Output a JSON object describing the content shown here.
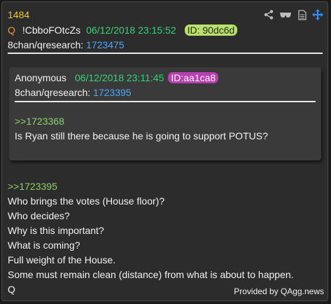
{
  "post": {
    "number": "1484",
    "q_mark": "Q",
    "tripcode": "!CbboFOtcZs",
    "date": "06/12/2018 23:15:52",
    "id": "ID: 90dc6d",
    "board": "8chan/qresearch:",
    "post_link": "1723475"
  },
  "toolbar": {
    "icons": [
      "share-icon",
      "glasses-icon",
      "document-icon",
      "move-icon"
    ],
    "accent": "#2f8fff"
  },
  "quoted": {
    "author": "Anonymous",
    "date": "06/12/2018 23:11:45",
    "id": "ID:aa1ca8",
    "board": "8chan/qresearch:",
    "post_link": "1723395",
    "reply_ref": ">>1723368",
    "text": "Is Ryan still there because he is going to support POTUS?"
  },
  "body": {
    "reply_ref": ">>1723395",
    "lines": [
      "Who brings the votes (House floor)?",
      "Who decides?",
      "Why is this important?",
      "What is coming?",
      "Full weight of the House.",
      "Some must remain clean (distance) from what is about to happen.",
      "Q"
    ]
  },
  "footer": {
    "provided": "Provided by QAgg.news"
  },
  "colors": {
    "number": "#f3c53b",
    "date": "#38d27a",
    "link": "#4aa8ff",
    "id_badge": "#b8e06a",
    "id_badge_quoted": "#b83fb2",
    "greentext": "#8fd26a"
  }
}
